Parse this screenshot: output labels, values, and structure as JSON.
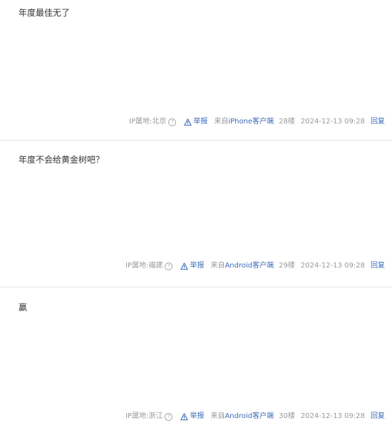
{
  "posts": [
    {
      "content": "年度最佳无了",
      "ip_location": "IP属地:北京",
      "report_label": "举报",
      "client_prefix": "来自",
      "client_name": "iPhone客户端",
      "floor": "28楼",
      "time": "2024-12-13 09:28",
      "reply_label": "回复"
    },
    {
      "content": "年度不会给黄金树吧？",
      "ip_location": "IP属地:福建",
      "report_label": "举报",
      "client_prefix": "来自",
      "client_name": "Android客户端",
      "floor": "29楼",
      "time": "2024-12-13 09:28",
      "reply_label": "回复"
    },
    {
      "content": "赢",
      "ip_location": "IP属地:浙江",
      "report_label": "举报",
      "client_prefix": "来自",
      "client_name": "Android客户端",
      "floor": "30楼",
      "time": "2024-12-13 09:28",
      "reply_label": "回复"
    }
  ],
  "colors": {
    "text": "#333333",
    "meta": "#999999",
    "link": "#3d6cb8",
    "divider": "#e5e5e5"
  },
  "icons": {
    "help": "question-circle-icon",
    "report": "warning-triangle-icon"
  }
}
